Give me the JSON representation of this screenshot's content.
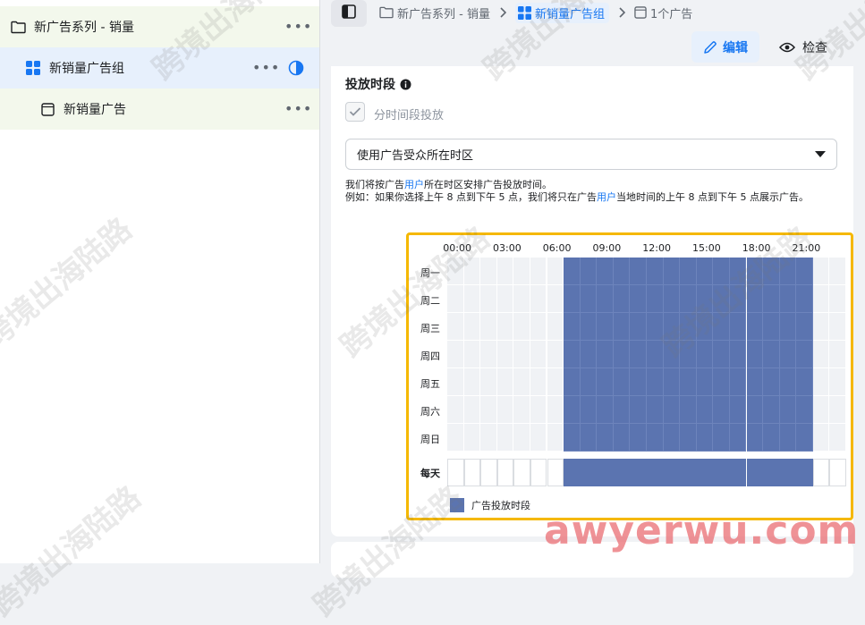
{
  "sidebar": {
    "campaign": {
      "label": "新广告系列 - 销量",
      "more": "•••"
    },
    "adset": {
      "label": "新销量广告组",
      "more": "•••"
    },
    "ad": {
      "label": "新销量广告",
      "more": "•••"
    }
  },
  "breadcrumb": {
    "campaign": "新广告系列 - 销量",
    "adset": "新销量广告组",
    "ads": "1个广告"
  },
  "toolbar": {
    "edit_label": "编辑",
    "view_label": "检查"
  },
  "schedule": {
    "title": "投放时段",
    "checkbox_label": "分时间段投放",
    "checkbox_checked": true,
    "timezone_select": "使用广告受众所在时区",
    "help_line1_pre": "我们将按广告",
    "help_line1_link": "用户",
    "help_line1_post": "所在时区安排广告投放时间。",
    "help_line2_pre": "例如：如果你选择上午 8 点到下午 5 点，我们将只在广告",
    "help_line2_link": "用户",
    "help_line2_post": "当地时间的上午 8 点到下午 5 点展示广告。",
    "hour_labels": [
      "00:00",
      "03:00",
      "06:00",
      "09:00",
      "12:00",
      "15:00",
      "18:00",
      "21:00"
    ],
    "days": [
      "周一",
      "周二",
      "周三",
      "周四",
      "周五",
      "周六",
      "周日"
    ],
    "every_day_label": "每天",
    "selected_start_hour": 7,
    "selected_end_hour": 22,
    "legend_label": "广告投放时段",
    "accent_color": "#5b74b0",
    "highlight_border_color": "#f5b800"
  },
  "watermarks": {
    "text": "跨境出海陆路",
    "site": "awyerwu.com"
  }
}
